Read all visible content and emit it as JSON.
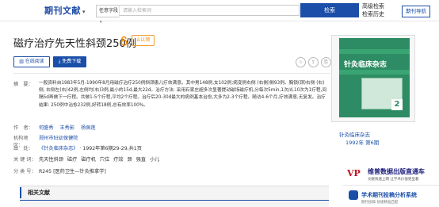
{
  "header": {
    "logo": "期刊文献",
    "search_type": "任意字段",
    "search_placeholder": "请输入检索词",
    "search_button": "检索",
    "advanced_search": "高级检索",
    "search_history": "检索历史",
    "nav_button": "期刊导航"
  },
  "article": {
    "title": "磁疗治疗先天性斜颈250例",
    "badge": "认领",
    "read_button": "在线阅读",
    "download_button": "免费下载",
    "abstract_label": "摘　要：",
    "abstract": "一般资料自1983年5月-1990年8月用磁疗治疗250例斜颈患儿疗效满意。其中男148例,女102例;病变例右侧 (右側)侧93例。胸锁(颈)右侧 (右)侧, 右侧左(右)42例,左侧均(右)3例,最小的15d,最大22d。治疗方法: 采用石家庄超多次显著提动磁场磁疗机,分每次5min,1次/d,10次为1疗程,间隔5d再做下一疗程。共做1-5个疗程,平均2个疗程。治疗后20-30d最大的病例基本治愈,大多为2-3个疗程。随访4-6个月,疗效满意,无复发。治疗结果: 250例中治愈232例,好转18例,总有效率100%。",
    "authors_label": "作　者：",
    "authors": [
      "何盛秀",
      "王秀影",
      "杨佩莲"
    ],
    "org_label": "机构地区：",
    "org": "郑州市妇幼保健院",
    "source_label": "出　处：",
    "source_journal": "《针灸临床杂志》",
    "source_issue": "1992年第6期29-29,共1页",
    "keywords_label": "关 键 词：",
    "keywords": [
      "先天性斜颈",
      "磁疗",
      "磁疗机",
      "穴位",
      "疗效",
      "颈",
      "强直",
      "小儿"
    ],
    "class_label": "分 类 号：",
    "class_code": "R245 [医药卫生—针灸推拿学]",
    "related_heading": "相关文献"
  },
  "sidebar": {
    "cover_title": "针灸临床杂志",
    "cover_number": "2",
    "journal_name": "针灸临床杂志",
    "journal_issue": "1992年 第6期",
    "ad1_title": "维普数据出版直通车",
    "ad1_sub": "文献快速上网 让学术价值更显著",
    "ad2_title": "学术期刊投稿分析系统",
    "ad2_sub": "期刊投稿 快速精准匹配"
  }
}
